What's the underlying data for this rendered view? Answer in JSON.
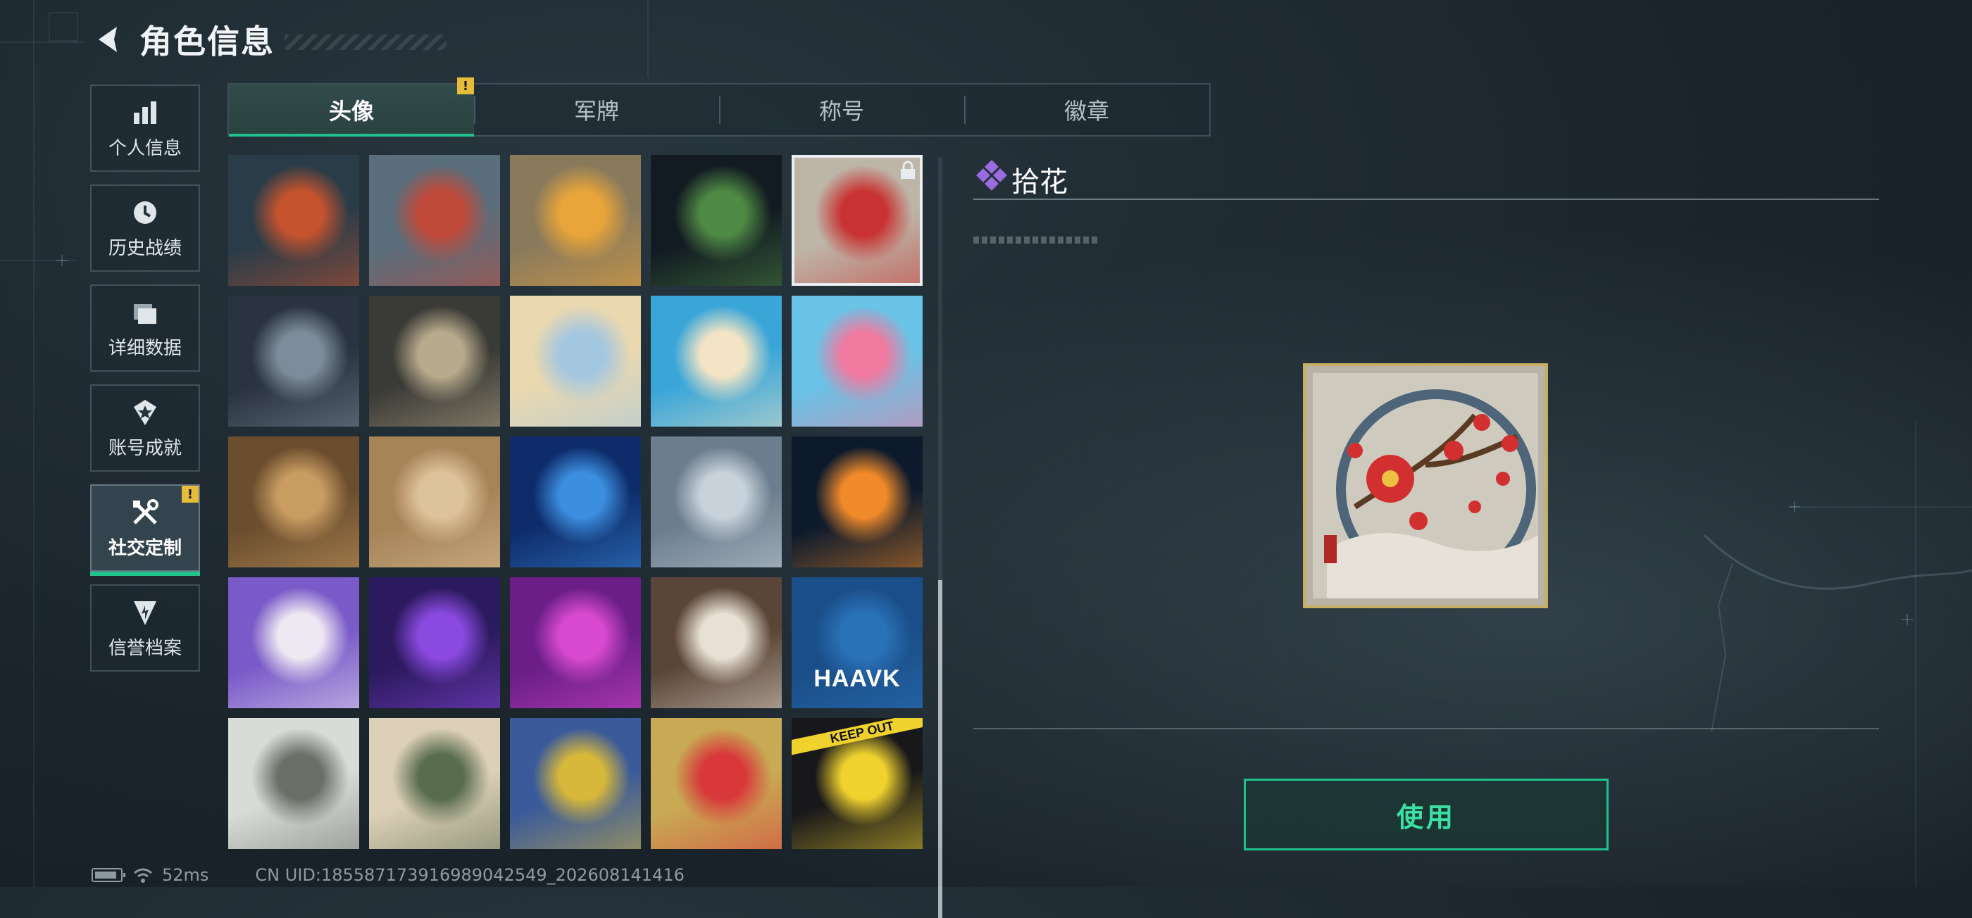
{
  "header": {
    "title": "角色信息",
    "back_icon": "back-arrow-icon"
  },
  "sidebar": {
    "items": [
      {
        "label": "个人信息",
        "icon": "bar-chart-icon",
        "active": false,
        "notice": false
      },
      {
        "label": "历史战绩",
        "icon": "clock-history-icon",
        "active": false,
        "notice": false
      },
      {
        "label": "详细数据",
        "icon": "folder-icon",
        "active": false,
        "notice": false
      },
      {
        "label": "账号成就",
        "icon": "achievement-icon",
        "active": false,
        "notice": false
      },
      {
        "label": "社交定制",
        "icon": "tools-icon",
        "active": true,
        "notice": true,
        "notice_text": "!"
      },
      {
        "label": "信誉档案",
        "icon": "shield-emblem-icon",
        "active": false,
        "notice": false
      }
    ]
  },
  "tabs": [
    {
      "label": "头像",
      "active": true,
      "notice": true,
      "notice_text": "!"
    },
    {
      "label": "军牌",
      "active": false,
      "notice": false
    },
    {
      "label": "称号",
      "active": false,
      "notice": false
    },
    {
      "label": "徽章",
      "active": false,
      "notice": false
    }
  ],
  "avatars": [
    {
      "name": "crossed-swords-avatar",
      "palette": [
        "#2a3c48",
        "#c5532e"
      ],
      "selected": false,
      "locked": false
    },
    {
      "name": "castle-tower-avatar",
      "palette": [
        "#5a6e7c",
        "#c04a3a"
      ],
      "selected": false,
      "locked": false
    },
    {
      "name": "mech-pilot-avatar",
      "palette": [
        "#8a7a5c",
        "#e7a53a"
      ],
      "selected": false,
      "locked": false
    },
    {
      "name": "soldier-with-box-avatar",
      "palette": [
        "#121a22",
        "#4f8a44"
      ],
      "selected": false,
      "locked": false
    },
    {
      "name": "plum-blossom-avatar",
      "palette": [
        "#bdb6a8",
        "#c83232"
      ],
      "selected": true,
      "locked": true
    },
    {
      "name": "sniper-soldier-avatar",
      "palette": [
        "#2a3440",
        "#7d8c9a"
      ],
      "selected": false,
      "locked": false
    },
    {
      "name": "tactical-map-avatar",
      "palette": [
        "#3a3a36",
        "#b8aa8c"
      ],
      "selected": false,
      "locked": false
    },
    {
      "name": "beach-girl-avatar",
      "palette": [
        "#e9d8b0",
        "#a4c7e0"
      ],
      "selected": false,
      "locked": false
    },
    {
      "name": "surfer-boy-avatar",
      "palette": [
        "#3aa6d8",
        "#f2e4c4"
      ],
      "selected": false,
      "locked": false
    },
    {
      "name": "flamingo-float-avatar",
      "palette": [
        "#68c3e6",
        "#f07aa0"
      ],
      "selected": false,
      "locked": false
    },
    {
      "name": "bearded-man-avatar",
      "palette": [
        "#6b4e2e",
        "#c99c62"
      ],
      "selected": false,
      "locked": false
    },
    {
      "name": "desert-soldier-avatar",
      "palette": [
        "#a78358",
        "#ddc39a"
      ],
      "selected": false,
      "locked": false
    },
    {
      "name": "blue-helmet-avatar",
      "palette": [
        "#0e2c6a",
        "#3c8ede"
      ],
      "selected": false,
      "locked": false
    },
    {
      "name": "lone-chair-avatar",
      "palette": [
        "#6c7e8e",
        "#c8d2da"
      ],
      "selected": false,
      "locked": false
    },
    {
      "name": "burning-planet-avatar",
      "palette": [
        "#0c1a2c",
        "#f08a2a"
      ],
      "selected": false,
      "locked": false
    },
    {
      "name": "screaming-cat-avatar",
      "palette": [
        "#7a5ac8",
        "#ede8f2"
      ],
      "selected": false,
      "locked": false
    },
    {
      "name": "glasses-man-avatar",
      "palette": [
        "#2c1a5e",
        "#8a4ae0"
      ],
      "selected": false,
      "locked": false
    },
    {
      "name": "goggles-woman-avatar",
      "palette": [
        "#6a1e86",
        "#d84ad0"
      ],
      "selected": false,
      "locked": false
    },
    {
      "name": "star-emblem-avatar",
      "palette": [
        "#5a4638",
        "#e8e0d4"
      ],
      "selected": false,
      "locked": false
    },
    {
      "name": "haavk-logo-avatar",
      "palette": [
        "#1a4e88",
        "#2a72b8"
      ],
      "selected": false,
      "locked": false
    },
    {
      "name": "helmet-kid-avatar",
      "palette": [
        "#d8dcd8",
        "#6a7068"
      ],
      "selected": false,
      "locked": false
    },
    {
      "name": "cap-soldier-avatar",
      "palette": [
        "#dcd0b8",
        "#5a6c4e"
      ],
      "selected": false,
      "locked": false
    },
    {
      "name": "totem-robot-avatar",
      "palette": [
        "#3a5a9a",
        "#d8b83a"
      ],
      "selected": false,
      "locked": false
    },
    {
      "name": "octopus-wave-avatar",
      "palette": [
        "#c8aa54",
        "#d8383a"
      ],
      "selected": false,
      "locked": false
    },
    {
      "name": "goose-keep-out-avatar",
      "palette": [
        "#18181a",
        "#f0d22e"
      ],
      "selected": false,
      "locked": false
    }
  ],
  "haavk_text": "HAAVK",
  "tape_text": "KEEP OUT",
  "detail": {
    "name": "拾花",
    "name_icon": "purple-diamond-icon",
    "preview": "plum-blossom-preview",
    "use_button": "使用"
  },
  "status": {
    "ping": "52ms",
    "uid": "CN UID:185587173916989042549_202608141416"
  },
  "colors": {
    "accent": "#22c38e",
    "notice": "#e5bd3a",
    "button_text": "#3ce0a4",
    "diamond": "#9b6be0"
  }
}
